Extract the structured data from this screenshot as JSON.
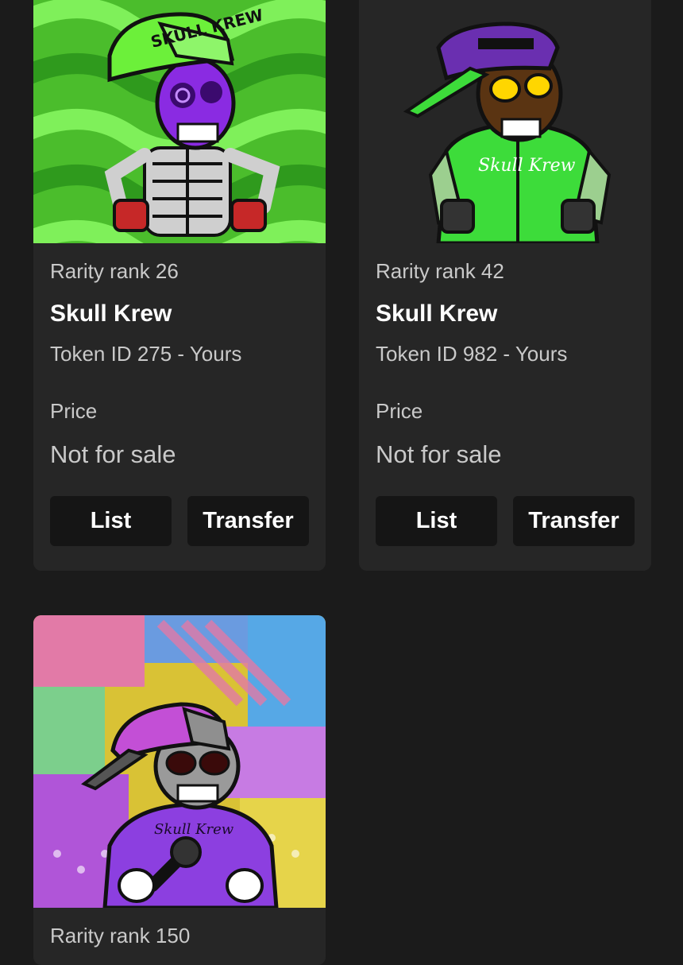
{
  "cards": [
    {
      "rarity": "Rarity rank 26",
      "name": "Skull Krew",
      "token": "Token ID 275 - Yours",
      "price_label": "Price",
      "price_value": "Not for sale",
      "list_label": "List",
      "transfer_label": "Transfer",
      "art": {
        "cap_text": "SKULL KREW",
        "background": "#5fd63a",
        "skull": "#8a2be2"
      }
    },
    {
      "rarity": "Rarity rank 42",
      "name": "Skull Krew",
      "token": "Token ID 982 - Yours",
      "price_label": "Price",
      "price_value": "Not for sale",
      "list_label": "List",
      "transfer_label": "Transfer",
      "art": {
        "jacket_text": "Skull Krew",
        "background": "#262626",
        "cap": "#6a2fb0"
      }
    },
    {
      "rarity": "Rarity rank 150",
      "art": {
        "jacket_text": "Skull Krew",
        "cap": "#c34fd6",
        "jacket": "#8c3fe0"
      }
    }
  ]
}
